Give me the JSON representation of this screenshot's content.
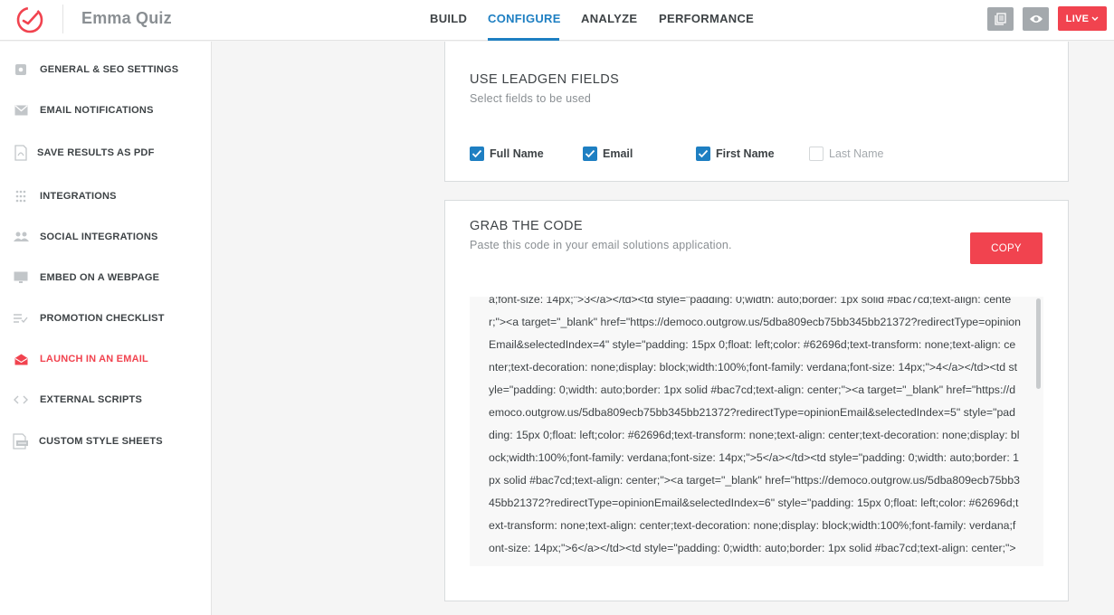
{
  "app": {
    "title": "Emma Quiz"
  },
  "nav": {
    "tabs": [
      {
        "label": "BUILD"
      },
      {
        "label": "CONFIGURE"
      },
      {
        "label": "ANALYZE"
      },
      {
        "label": "PERFORMANCE"
      }
    ],
    "active_tab": "CONFIGURE"
  },
  "toolbar": {
    "live_label": "LIVE"
  },
  "sidebar": {
    "items": [
      {
        "label": "GENERAL & SEO SETTINGS",
        "icon": "settings-icon"
      },
      {
        "label": "EMAIL NOTIFICATIONS",
        "icon": "envelope-icon"
      },
      {
        "label": "SAVE RESULTS AS PDF",
        "icon": "pdf-icon"
      },
      {
        "label": "INTEGRATIONS",
        "icon": "grid-dots-icon"
      },
      {
        "label": "SOCIAL INTEGRATIONS",
        "icon": "people-icon"
      },
      {
        "label": "EMBED ON A WEBPAGE",
        "icon": "monitor-icon"
      },
      {
        "label": "PROMOTION CHECKLIST",
        "icon": "checklist-icon"
      },
      {
        "label": "LAUNCH IN AN EMAIL",
        "icon": "open-envelope-icon"
      },
      {
        "label": "EXTERNAL SCRIPTS",
        "icon": "code-icon"
      },
      {
        "label": "CUSTOM STYLE SHEETS",
        "icon": "css-file-icon"
      }
    ],
    "active_item": "LAUNCH IN AN EMAIL"
  },
  "leadgen": {
    "title": "USE LEADGEN FIELDS",
    "subtitle": "Select fields to be used",
    "fields": [
      {
        "label": "Full Name",
        "checked": true
      },
      {
        "label": "Email",
        "checked": true
      },
      {
        "label": "First Name",
        "checked": true
      },
      {
        "label": "Last Name",
        "checked": false
      }
    ]
  },
  "code": {
    "title": "GRAB THE CODE",
    "subtitle": "Paste this code in your email solutions application.",
    "copy_label": "COPY",
    "snippet": "a;font-size: 14px;\">3</a></td><td style=\"padding: 0;width: auto;border: 1px solid #bac7cd;text-align: center;\"><a target=\"_blank\" href=\"https://democo.outgrow.us/5dba809ecb75bb345bb21372?redirectType=opinionEmail&selectedIndex=4\" style=\"padding: 15px 0;float: left;color: #62696d;text-transform: none;text-align: center;text-decoration: none;display: block;width:100%;font-family: verdana;font-size: 14px;\">4</a></td><td style=\"padding: 0;width: auto;border: 1px solid #bac7cd;text-align: center;\"><a target=\"_blank\" href=\"https://democo.outgrow.us/5dba809ecb75bb345bb21372?redirectType=opinionEmail&selectedIndex=5\" style=\"padding: 15px 0;float: left;color: #62696d;text-transform: none;text-align: center;text-decoration: none;display: block;width:100%;font-family: verdana;font-size: 14px;\">5</a></td><td style=\"padding: 0;width: auto;border: 1px solid #bac7cd;text-align: center;\"><a target=\"_blank\" href=\"https://democo.outgrow.us/5dba809ecb75bb345bb21372?redirectType=opinionEmail&selectedIndex=6\" style=\"padding: 15px 0;float: left;color: #62696d;text-transform: none;text-align: center;text-decoration: none;display: block;width:100%;font-family: verdana;font-size: 14px;\">6</a></td><td style=\"padding: 0;width: auto;border: 1px solid #bac7cd;text-align: center;\"><a target=\"_blank\" href=\"https://de"
  },
  "colors": {
    "accent_blue": "#1e7fc2",
    "accent_red": "#f1434f"
  }
}
